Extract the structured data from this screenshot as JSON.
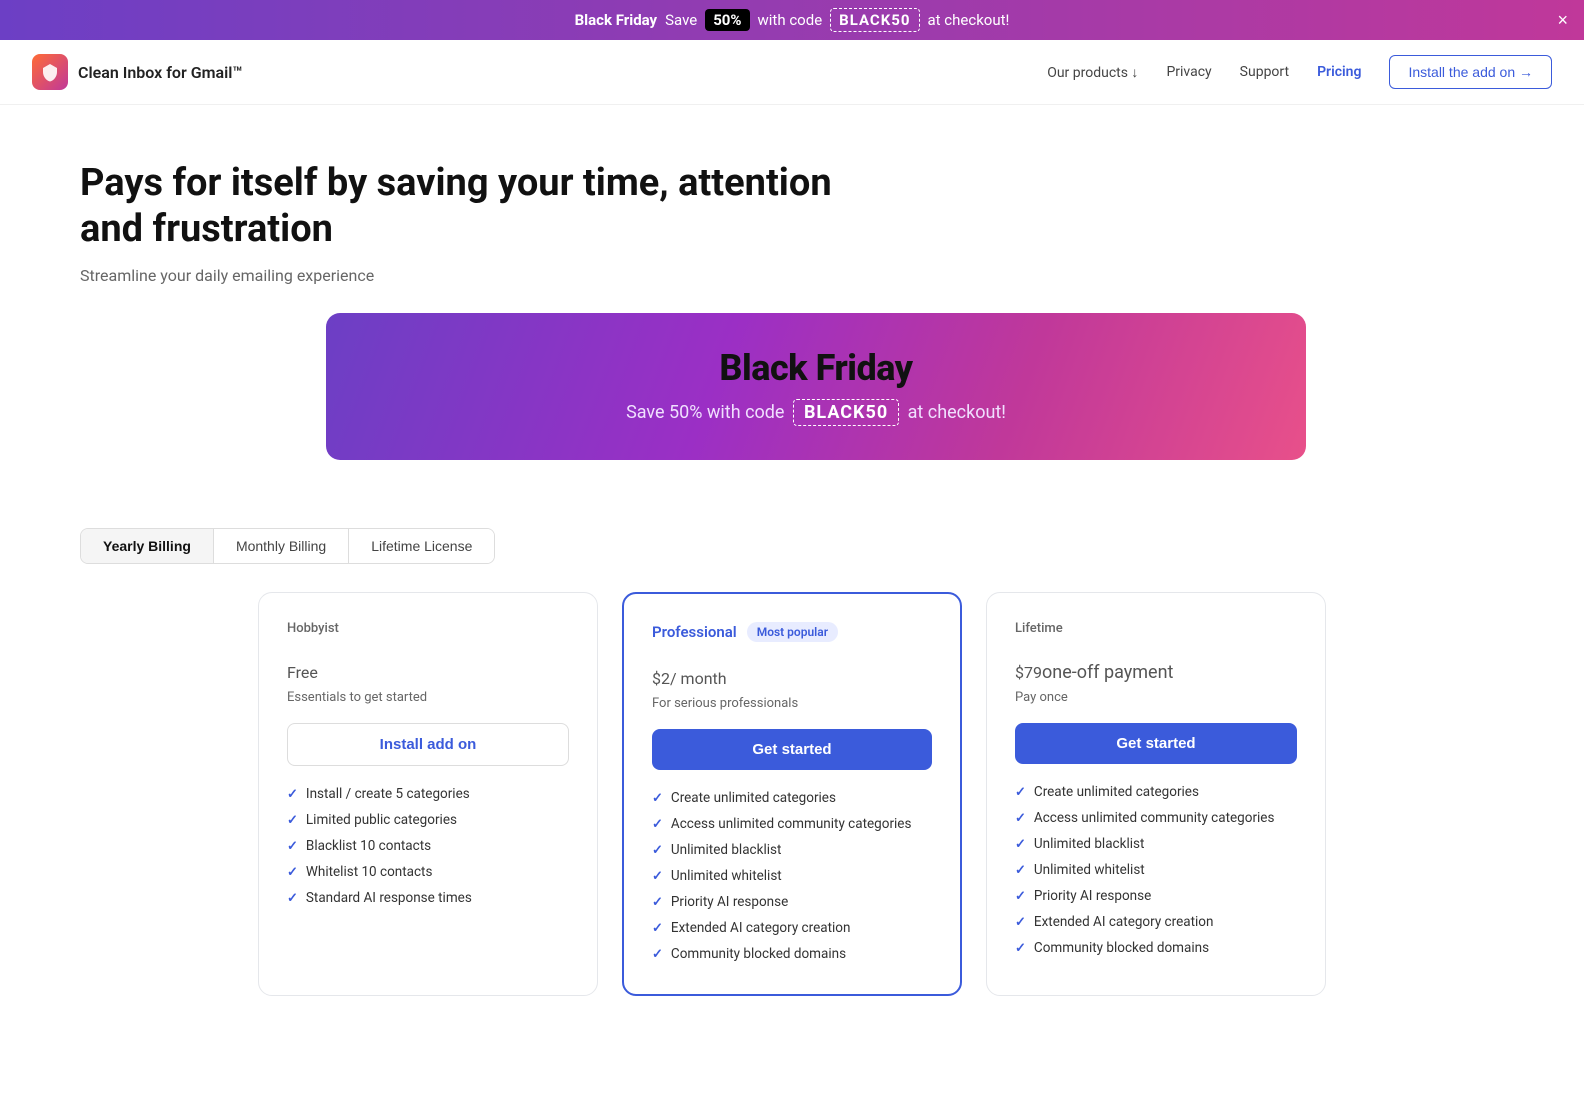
{
  "banner": {
    "text_before": "Black Friday",
    "save_label": "Save",
    "save_pct": "50%",
    "with_code": "with code",
    "code": "BLACK50",
    "at_checkout": "at checkout!"
  },
  "nav": {
    "logo_text": "Clean Inbox for Gmail™",
    "logo_icon": "🛡",
    "links": [
      {
        "label": "Our products ↓",
        "id": "our-products"
      },
      {
        "label": "Privacy",
        "id": "privacy"
      },
      {
        "label": "Support",
        "id": "support"
      },
      {
        "label": "Pricing",
        "id": "pricing",
        "highlight": true
      }
    ],
    "install_btn": "Install the add on →"
  },
  "hero": {
    "title": "Pays for itself by saving your time, attention and frustration",
    "subtitle": "Streamline your daily emailing experience"
  },
  "bf_banner": {
    "title": "Black Friday",
    "subtitle_before": "Save 50% with code",
    "code": "BLACK50",
    "subtitle_after": "at checkout!"
  },
  "billing": {
    "tabs": [
      "Yearly Billing",
      "Monthly Billing",
      "Lifetime License"
    ],
    "active": 0
  },
  "plans": [
    {
      "id": "hobbyist",
      "tier": "Hobbyist",
      "price": "Free",
      "price_suffix": "",
      "desc": "Essentials to get started",
      "btn_label": "Install add on",
      "btn_type": "outline",
      "featured": false,
      "features": [
        "Install / create 5 categories",
        "Limited public categories",
        "Blacklist 10 contacts",
        "Whitelist 10 contacts",
        "Standard AI response times"
      ]
    },
    {
      "id": "professional",
      "tier": "Professional",
      "price": "$2",
      "price_suffix": "/ month",
      "desc": "For serious professionals",
      "btn_label": "Get started",
      "btn_type": "filled",
      "featured": true,
      "most_popular": "Most popular",
      "features": [
        "Create unlimited categories",
        "Access unlimited community categories",
        "Unlimited blacklist",
        "Unlimited whitelist",
        "Priority AI response",
        "Extended AI category creation",
        "Community blocked domains"
      ]
    },
    {
      "id": "lifetime",
      "tier": "Lifetime",
      "price": "$79",
      "price_suffix": "one-off payment",
      "desc": "Pay once",
      "btn_label": "Get started",
      "btn_type": "filled",
      "featured": false,
      "features": [
        "Create unlimited categories",
        "Access unlimited community categories",
        "Unlimited blacklist",
        "Unlimited whitelist",
        "Priority AI response",
        "Extended AI category creation",
        "Community blocked domains"
      ]
    }
  ]
}
